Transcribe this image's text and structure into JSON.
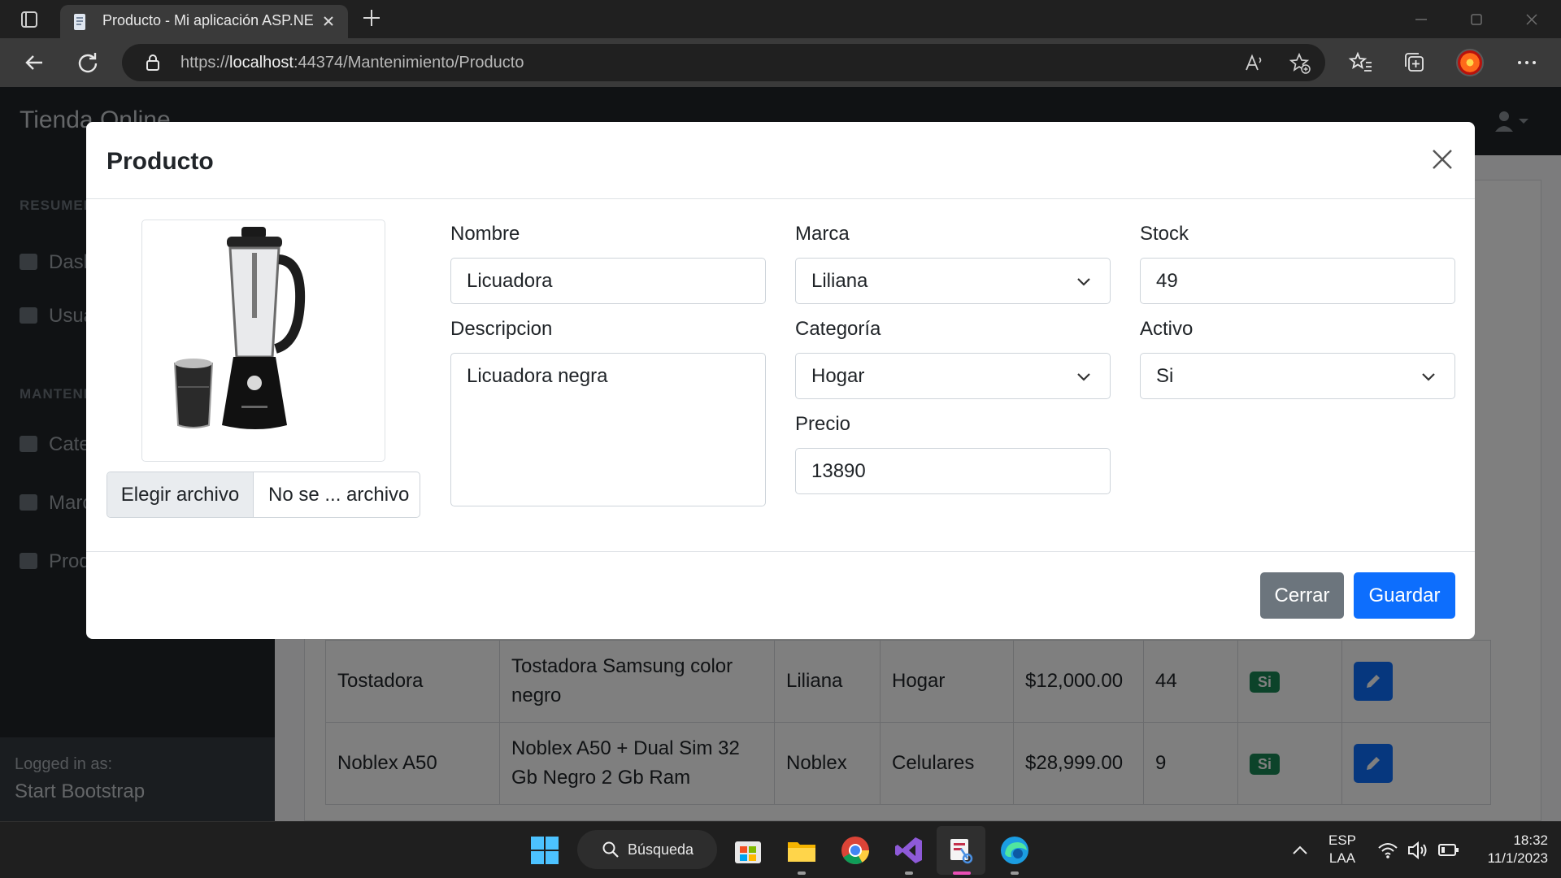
{
  "browser": {
    "tab_title": "Producto - Mi aplicación ASP.NET Core MVC",
    "url_prefix": "https://",
    "url_host": "localhost",
    "url_rest": ":44374/Mantenimiento/Producto"
  },
  "app": {
    "brand": "Tienda Online",
    "sidebar": {
      "heading_summary": "RESUMEN",
      "heading_maint": "MANTENIMIENTO",
      "items": [
        {
          "label": "Dashboard"
        },
        {
          "label": "Usuarios"
        },
        {
          "label": "Categorías"
        },
        {
          "label": "Marcas"
        },
        {
          "label": "Productos"
        }
      ],
      "footer_caption": "Logged in as:",
      "footer_user": "Start Bootstrap"
    },
    "table": {
      "rows": [
        {
          "nombre": "Tostadora",
          "descripcion": "Tostadora Samsung color negro",
          "marca": "Liliana",
          "categoria": "Hogar",
          "precio": "$12,000.00",
          "stock": "44",
          "activo": "Si"
        },
        {
          "nombre": "Noblex A50",
          "descripcion": "Noblex A50 + Dual Sim 32 Gb Negro 2 Gb Ram",
          "marca": "Noblex",
          "categoria": "Celulares",
          "precio": "$28,999.00",
          "stock": "9",
          "activo": "Si"
        }
      ]
    }
  },
  "modal": {
    "title": "Producto",
    "file_button": "Elegir archivo",
    "file_name": "No se ... archivo",
    "labels": {
      "nombre": "Nombre",
      "descripcion": "Descripcion",
      "marca": "Marca",
      "categoria": "Categoría",
      "precio": "Precio",
      "stock": "Stock",
      "activo": "Activo"
    },
    "values": {
      "nombre": "Licuadora",
      "descripcion": "Licuadora negra",
      "marca": "Liliana",
      "categoria": "Hogar",
      "precio": "13890",
      "stock": "49",
      "activo": "Si"
    },
    "buttons": {
      "close": "Cerrar",
      "save": "Guardar"
    }
  },
  "taskbar": {
    "search_label": "Búsqueda",
    "lang_top": "ESP",
    "lang_bottom": "LAA",
    "time": "18:32",
    "date": "11/1/2023"
  },
  "colors": {
    "primary": "#0d6efd",
    "secondary": "#6c757d",
    "success": "#198754",
    "dark": "#212529"
  }
}
